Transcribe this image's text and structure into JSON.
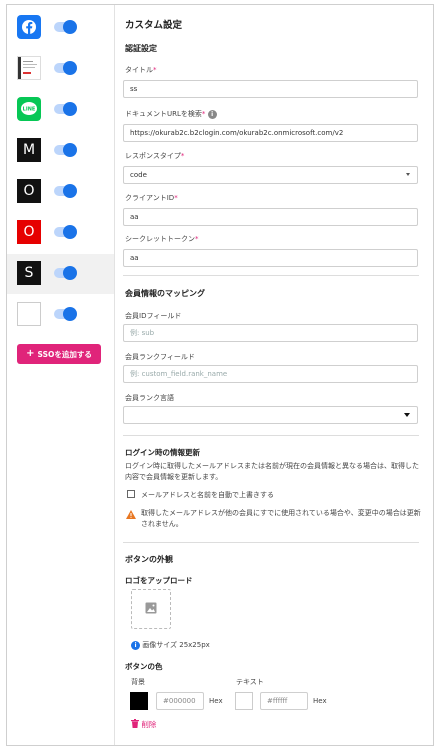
{
  "sidebar": {
    "items": [
      {
        "letter": "",
        "icon": "facebook-icon",
        "bg": "#1877f2"
      },
      {
        "letter": "",
        "icon": "thumbnail-icon",
        "bg": "#ffffff"
      },
      {
        "letter": "LINE",
        "icon": "line-icon",
        "bg": "#06c755"
      },
      {
        "letter": "M",
        "icon": "m-icon",
        "bg": "#111111"
      },
      {
        "letter": "O",
        "icon": "o-icon",
        "bg": "#111111"
      },
      {
        "letter": "O",
        "icon": "o-red-icon",
        "bg": "#ee0000"
      },
      {
        "letter": "S",
        "icon": "s-icon",
        "bg": "#111111"
      },
      {
        "letter": "",
        "icon": "blank-icon",
        "bg": "#ffffff"
      }
    ],
    "add_button": "SSOを追加する"
  },
  "main": {
    "title": "カスタム設定",
    "auth_section": "認証設定",
    "title_label": "タイトル",
    "title_value": "ss",
    "doc_url_label": "ドキュメントURLを検索",
    "doc_url_value": "https://okurab2c.b2clogin.com/okurab2c.onmicrosoft.com/v2",
    "response_type_label": "レスポンスタイプ",
    "response_type_value": "code",
    "client_id_label": "クライアントID",
    "client_id_value": "aa",
    "secret_label": "シークレットトークン",
    "secret_value": "aa",
    "mapping_section": "会員情報のマッピング",
    "member_id_label": "会員IDフィールド",
    "member_id_placeholder": "例: sub",
    "rank_field_label": "会員ランクフィールド",
    "rank_field_placeholder": "例: custom_field.rank_name",
    "rank_lang_label": "会員ランク言語",
    "rank_lang_value": "",
    "login_update_section": "ログイン時の情報更新",
    "login_update_desc": "ログイン時に取得したメールアドレスまたは名前が現在の会員情報と異なる場合は、取得した内容で会員情報を更新します。",
    "overwrite_checkbox": "メールアドレスと名前を自動で上書きする",
    "warning_text": "取得したメールアドレスが他の会員にすでに使用されている場合や、変更中の場合は更新されません。",
    "button_section": "ボタンの外観",
    "logo_upload_label": "ロゴをアップロード",
    "image_size_text": "画像サイズ 25x25px",
    "button_color_label": "ボタンの色",
    "bg_label": "背景",
    "bg_hex": "#000000",
    "bg_color": "#000000",
    "text_label": "テキスト",
    "text_hex": "#ffffff",
    "text_color": "#ffffff",
    "hex_label": "Hex",
    "delete_label": "削除"
  }
}
